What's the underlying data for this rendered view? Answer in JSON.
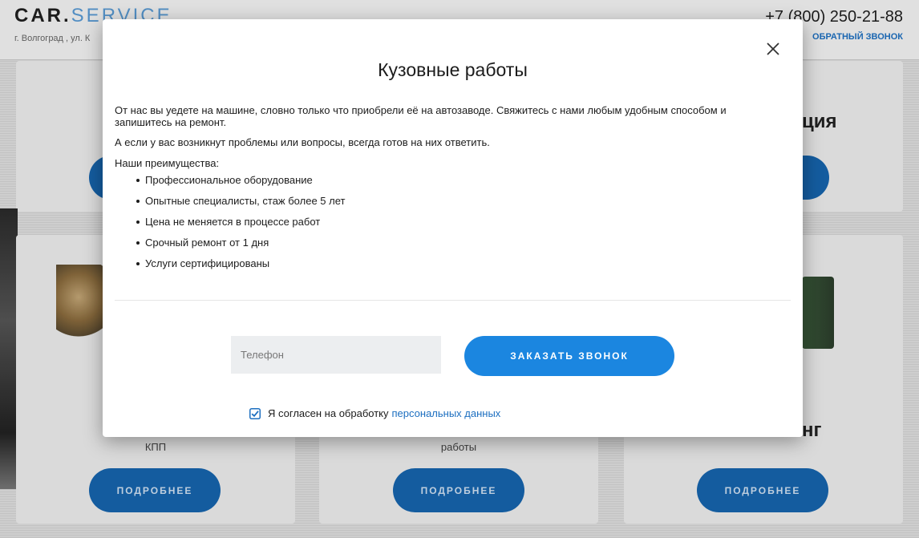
{
  "site": {
    "logo_main": "CAR.",
    "logo_accent": "SERVICE",
    "address": "г. Волгоград , ул. К",
    "phone": "+7 (800) 250-21-88",
    "callback_link": "ОБРАТНЫЙ ЗВОНОК"
  },
  "cards": {
    "top_right_partial_title": "ция",
    "bottom_left_sub": "КПП",
    "bottom_middle_sub": "работы",
    "bottom_right_partial_title": "нг",
    "more_label": "ПОДРОБНЕЕ"
  },
  "modal": {
    "title": "Кузовные работы",
    "paragraph1": "От нас вы уедете на машине, словно только что приобрели её на автозаводе. Свяжитесь с нами любым удобным способом и запишитесь на ремонт.",
    "paragraph2": "А если у вас возникнут проблемы или вопросы, всегда готов на них ответить.",
    "advantages_heading": "Наши преимущества:",
    "advantages": [
      "Профессиональное оборудование",
      "Опытные специалисты, стаж более 5 лет",
      "Цена не меняется в процессе работ",
      "Срочный ремонт от 1 дня",
      "Услуги сертифицированы"
    ],
    "phone_placeholder": "Телефон",
    "order_button": "ЗАКАЗАТЬ ЗВОНОК",
    "consent_text": "Я согласен на обработку",
    "consent_link": "персональных данных",
    "consent_checked": true
  },
  "icons": {
    "close": "close-icon",
    "checkbox": "checkbox-checked-icon"
  },
  "colors": {
    "accent": "#1b86e0",
    "link": "#1d6fc0",
    "card_button": "#1664ad"
  }
}
